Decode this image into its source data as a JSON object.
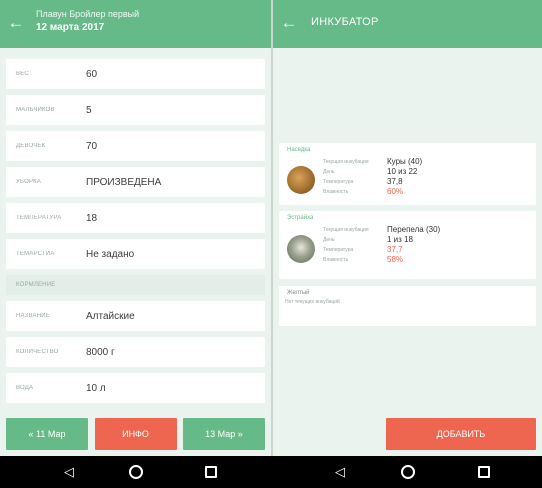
{
  "left": {
    "appbar": {
      "subtitle": "Плавун Бройлер первый",
      "date": "12 марта 2017"
    },
    "fields": [
      {
        "label": "ВЕС",
        "value": "60"
      },
      {
        "label": "МАЛЬЧИКОВ",
        "value": "5"
      },
      {
        "label": "ДЕВОЧЕК",
        "value": "70"
      },
      {
        "label": "УБОРКА",
        "value": "ПРОИЗВЕДЕНА"
      },
      {
        "label": "ТЕМПЕРАТУРА",
        "value": "18"
      },
      {
        "label": "ТЕМАРСТИА",
        "value": "Не задано"
      }
    ],
    "section": "КОРМЛЕНИЕ",
    "feed_fields": [
      {
        "label": "НАЗВАНИЕ",
        "value": "Алтайские"
      },
      {
        "label": "КОЛИЧЕСТВО",
        "value": "8000 г"
      },
      {
        "label": "ВОДА",
        "value": "10 л"
      }
    ],
    "buttons": {
      "prev": "« 11 Мар",
      "info": "ИНФО",
      "next": "13 Мар »"
    }
  },
  "right": {
    "appbar": {
      "title": "ИНКУБАТОР"
    },
    "cards": [
      {
        "title": "Наседка",
        "rows": [
          {
            "key": "Текущая инкубация",
            "value": "Куры (40)",
            "hot": false
          },
          {
            "key": "День",
            "value": "10 из 22",
            "hot": false
          },
          {
            "key": "Температура",
            "value": "37,8",
            "hot": false
          },
          {
            "key": "Влажность",
            "value": "60%",
            "hot": true
          }
        ]
      },
      {
        "title": "Эстрайха",
        "rows": [
          {
            "key": "Текущая инкубация",
            "value": "Перепела (30)",
            "hot": false
          },
          {
            "key": "День",
            "value": "1 из 18",
            "hot": false
          },
          {
            "key": "Температура",
            "value": "37,7",
            "hot": true
          },
          {
            "key": "Влажность",
            "value": "58%",
            "hot": true
          }
        ]
      }
    ],
    "empty_card": {
      "title": "Желтый",
      "note": "Нет текущих инкубаций"
    },
    "add_button": "ДОБАВИТЬ"
  },
  "colors": {
    "accent": "#66ba88",
    "danger": "#ef6650",
    "background": "#eaf3ee"
  },
  "icons": {
    "back": "arrow-left-icon",
    "nav_back": "triangle-back-icon",
    "nav_home": "circle-home-icon",
    "nav_recent": "square-recent-icon"
  }
}
